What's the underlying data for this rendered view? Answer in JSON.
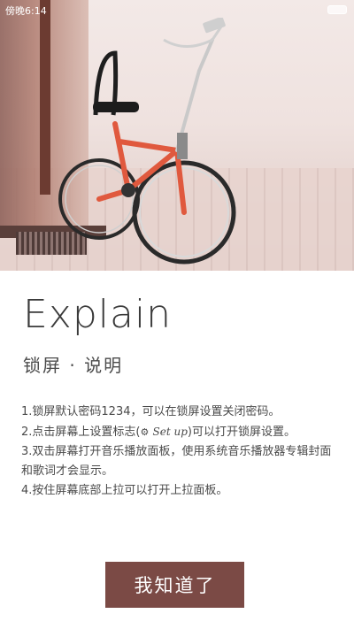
{
  "status_bar": {
    "time": "傍晚6:14"
  },
  "hero": {
    "icon": "bicycle-photo"
  },
  "title": "Explain",
  "subtitle": "锁屏 · 说明",
  "instructions": {
    "line1": "1.锁屏默认密码1234，可以在锁屏设置关闭密码。",
    "line2_before": "2.点击屏幕上设置标志(",
    "line2_icon": "⚙",
    "line2_setup": "Set up",
    "line2_after": ")可以打开锁屏设置。",
    "line3": "3.双击屏幕打开音乐播放面板，使用系统音乐播放器专辑封面和歌词才会显示。",
    "line4": "4.按住屏幕底部上拉可以打开上拉面板。"
  },
  "button": {
    "label": "我知道了"
  },
  "colors": {
    "button": "#7b4a45",
    "title": "#3a3a3a"
  }
}
